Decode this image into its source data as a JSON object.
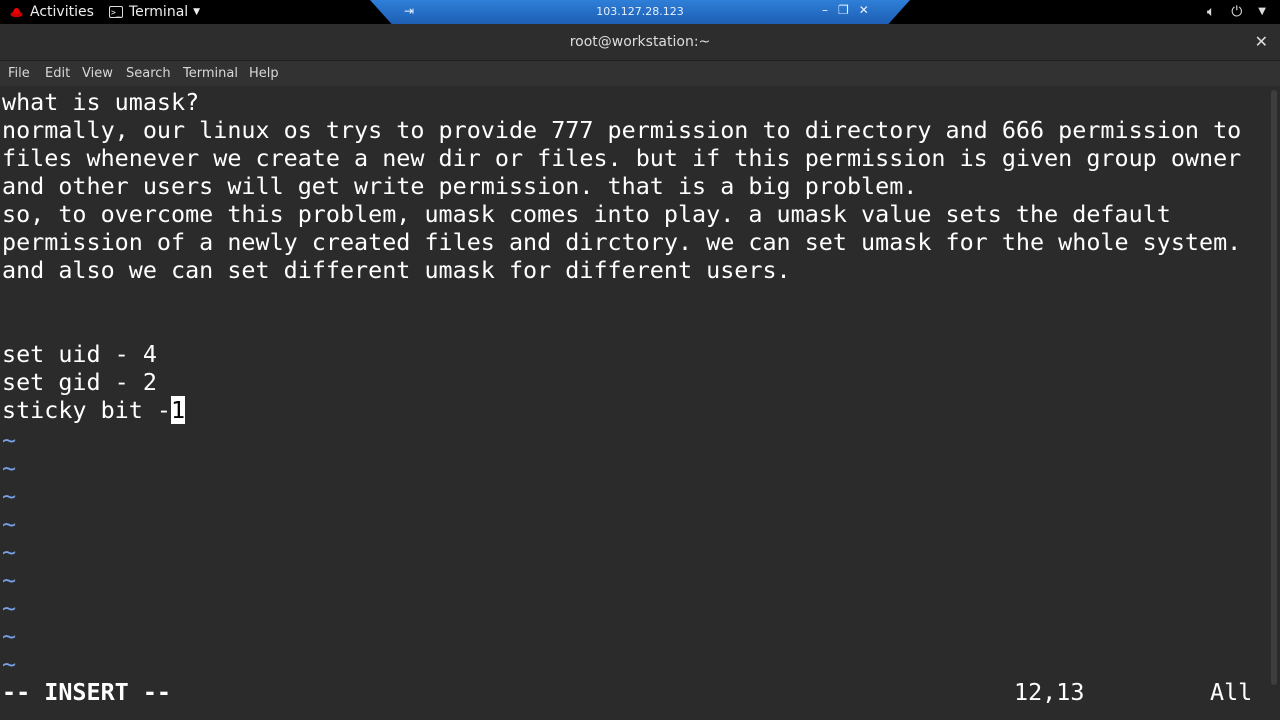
{
  "topbar": {
    "activities_label": "Activities",
    "app_menu_label": "Terminal",
    "app_icon_glyph": ">_",
    "tray_icons": [
      "volume-icon",
      "power-icon",
      "chevron-down-icon"
    ]
  },
  "remote": {
    "address": "103.127.28.123"
  },
  "window": {
    "title": "root@workstation:~",
    "close_glyph": "✕"
  },
  "menubar": {
    "items": [
      "File",
      "Edit",
      "View",
      "Search",
      "Terminal",
      "Help"
    ]
  },
  "editor": {
    "lines": [
      "what is umask?",
      "normally, our linux os trys to provide 777 permission to directory and 666 permission to",
      "files whenever we create a new dir or files. but if this permission is given group owner",
      "and other users will get write permission. that is a big problem.",
      "so, to overcome this problem, umask comes into play. a umask value sets the default",
      "permission of a newly created files and dirctory. we can set umask for the whole system.",
      "and also we can set different umask for different users.",
      "",
      "",
      "set uid - 4",
      "set gid - 2",
      "sticky bit -"
    ],
    "cursor_char": "1",
    "tilde": "~",
    "tilde_count": 9,
    "mode": "-- INSERT --",
    "position": "12,13",
    "scroll": "All"
  },
  "colors": {
    "background": "#2b2b2b",
    "text": "#ffffff",
    "tilde": "#7aa0e6",
    "remote_tab": "#2f7fd8"
  }
}
